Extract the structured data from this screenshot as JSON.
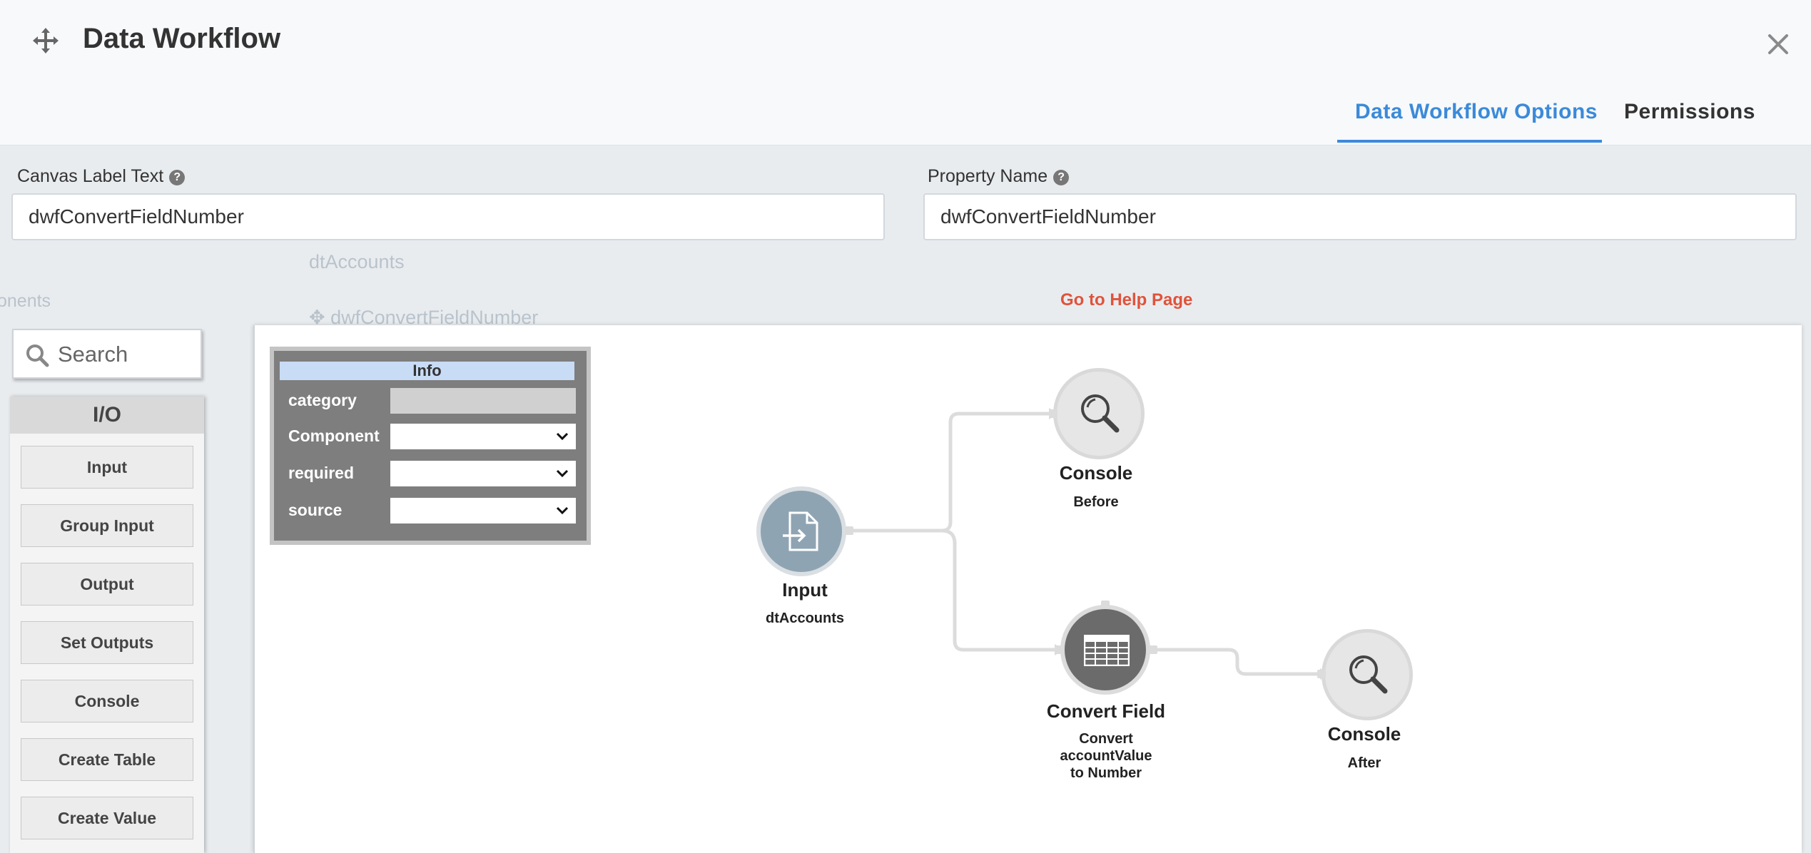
{
  "header": {
    "title": "Data Workflow",
    "tabs": [
      {
        "label": "Data Workflow Options",
        "active": true
      },
      {
        "label": "Permissions",
        "active": false
      }
    ]
  },
  "fields": {
    "canvas_label": {
      "label": "Canvas Label Text",
      "value": "dwfConvertFieldNumber"
    },
    "property_name": {
      "label": "Property Name",
      "value": "dwfConvertFieldNumber"
    }
  },
  "help_link": "Go to Help Page",
  "background_text": {
    "data_table": "dtAccounts",
    "workflow": "dwfConvertFieldNumber",
    "components": "onents"
  },
  "palette": {
    "search_placeholder": "Search",
    "section": "I/O",
    "items": [
      "Input",
      "Group Input",
      "Output",
      "Set Outputs",
      "Console",
      "Create Table",
      "Create Value"
    ]
  },
  "info_panel": {
    "title": "Info",
    "rows": [
      "category",
      "Component",
      "required",
      "source"
    ]
  },
  "nodes": {
    "input": {
      "title": "Input",
      "sub": "dtAccounts",
      "icon": "file-import-icon"
    },
    "console_before": {
      "title": "Console",
      "sub": "Before",
      "icon": "magnifier-icon"
    },
    "convert": {
      "title": "Convert Field",
      "sub_lines": [
        "Convert",
        "accountValue",
        "to Number"
      ],
      "icon": "table-icon"
    },
    "console_after": {
      "title": "Console",
      "sub": "After",
      "icon": "magnifier-icon"
    }
  },
  "colors": {
    "accent": "#3b8ad9",
    "help_link": "#e0533b",
    "node_input": "#8fa4b3",
    "node_console": "#e6e6e6",
    "node_convert": "#6b6b6b"
  }
}
